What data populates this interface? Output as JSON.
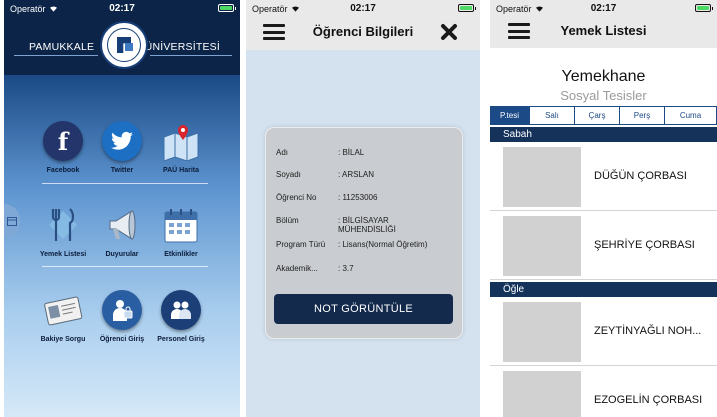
{
  "status": {
    "carrier": "Operatör",
    "time": "02:17"
  },
  "home": {
    "uni_left": "PAMUKKALE",
    "uni_right": "ÜNİVERSİTESİ",
    "tiles": [
      {
        "label": "Facebook",
        "icon": "facebook-icon"
      },
      {
        "label": "Twitter",
        "icon": "twitter-icon"
      },
      {
        "label": "PAÜ Harita",
        "icon": "map-icon"
      },
      {
        "label": "Yemek Listesi",
        "icon": "cutlery-icon"
      },
      {
        "label": "Duyurular",
        "icon": "megaphone-icon"
      },
      {
        "label": "Etkinlikler",
        "icon": "calendar-icon"
      },
      {
        "label": "Bakiye Sorgu",
        "icon": "id-card-icon"
      },
      {
        "label": "Öğrenci Giriş",
        "icon": "student-icon"
      },
      {
        "label": "Personel Giriş",
        "icon": "staff-icon"
      }
    ]
  },
  "student": {
    "title": "Öğrenci Bilgileri",
    "fields": [
      {
        "key": "Adı",
        "value": ": BİLAL"
      },
      {
        "key": "Soyadı",
        "value": ": ARSLAN"
      },
      {
        "key": "Öğrenci No",
        "value": ": 11253006"
      },
      {
        "key": "Bölüm",
        "value": ": BİLGİSAYAR MÜHENDİSLİĞİ"
      },
      {
        "key": "Program Türü",
        "value": ": Lisans(Normal Öğretim)"
      },
      {
        "key": "Akademik...",
        "value": ": 3.7"
      }
    ],
    "button": "NOT GÖRÜNTÜLE"
  },
  "menu": {
    "title": "Yemek Listesi",
    "place_main": "Yemekhane",
    "place_sub": "Sosyal Tesisler",
    "days": [
      "P.tesi",
      "Salı",
      "Çarş",
      "Perş",
      "Cuma"
    ],
    "active_day": 0,
    "sections": [
      {
        "name": "Sabah",
        "items": [
          "DÜĞÜN ÇORBASI",
          "ŞEHRİYE ÇORBASI"
        ]
      },
      {
        "name": "Öğle",
        "items": [
          "ZEYTİNYAĞLI NOH...",
          "EZOGELİN ÇORBASI"
        ]
      }
    ]
  },
  "colors": {
    "navy": "#0c2447",
    "accent": "#1b4a86",
    "button": "#132a4d"
  }
}
